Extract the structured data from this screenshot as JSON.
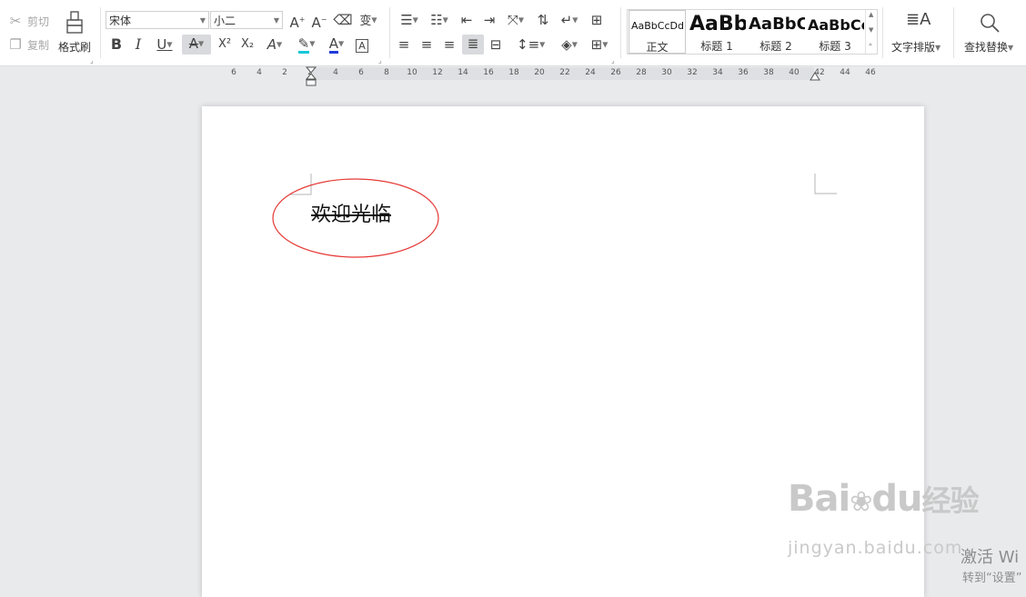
{
  "clipboard": {
    "cut": "剪切",
    "copy": "复制",
    "format_painter": "格式刷"
  },
  "font": {
    "family": "宋体",
    "size": "小二"
  },
  "text_format": {
    "bold": "B",
    "italic": "I",
    "underline": "U",
    "strike": "A",
    "superscript": "X²",
    "subscript": "X₂",
    "grow": "A",
    "shrink": "A",
    "font_color": "A",
    "char_border": "A",
    "phonetic": "变"
  },
  "styles": [
    {
      "sample": "AaBbCcDd",
      "name": "正文"
    },
    {
      "sample": "AaBb",
      "name": "标题 1"
    },
    {
      "sample": "AaBbC",
      "name": "标题 2"
    },
    {
      "sample": "AaBbCc",
      "name": "标题 3"
    }
  ],
  "right_tools": {
    "text_layout": "文字排版",
    "find_replace": "查找替换"
  },
  "ruler_labels": [
    "6",
    "4",
    "2",
    "2",
    "4",
    "6",
    "8",
    "10",
    "12",
    "14",
    "16",
    "18",
    "20",
    "22",
    "24",
    "26",
    "28",
    "30",
    "32",
    "34",
    "36",
    "38",
    "40",
    "42",
    "44",
    "46"
  ],
  "document": {
    "text": "欢迎光临"
  },
  "colors": {
    "highlight": "#16c7d9",
    "font_color": "#1f3bd8",
    "ellipse": "#e53935"
  },
  "watermark": {
    "logo_a": "Bai",
    "logo_b": "du",
    "logo_c": "经验",
    "url": "jingyan.baidu.com"
  },
  "activation": {
    "line1": "激活 Wi",
    "line2": "转到“设置”"
  }
}
